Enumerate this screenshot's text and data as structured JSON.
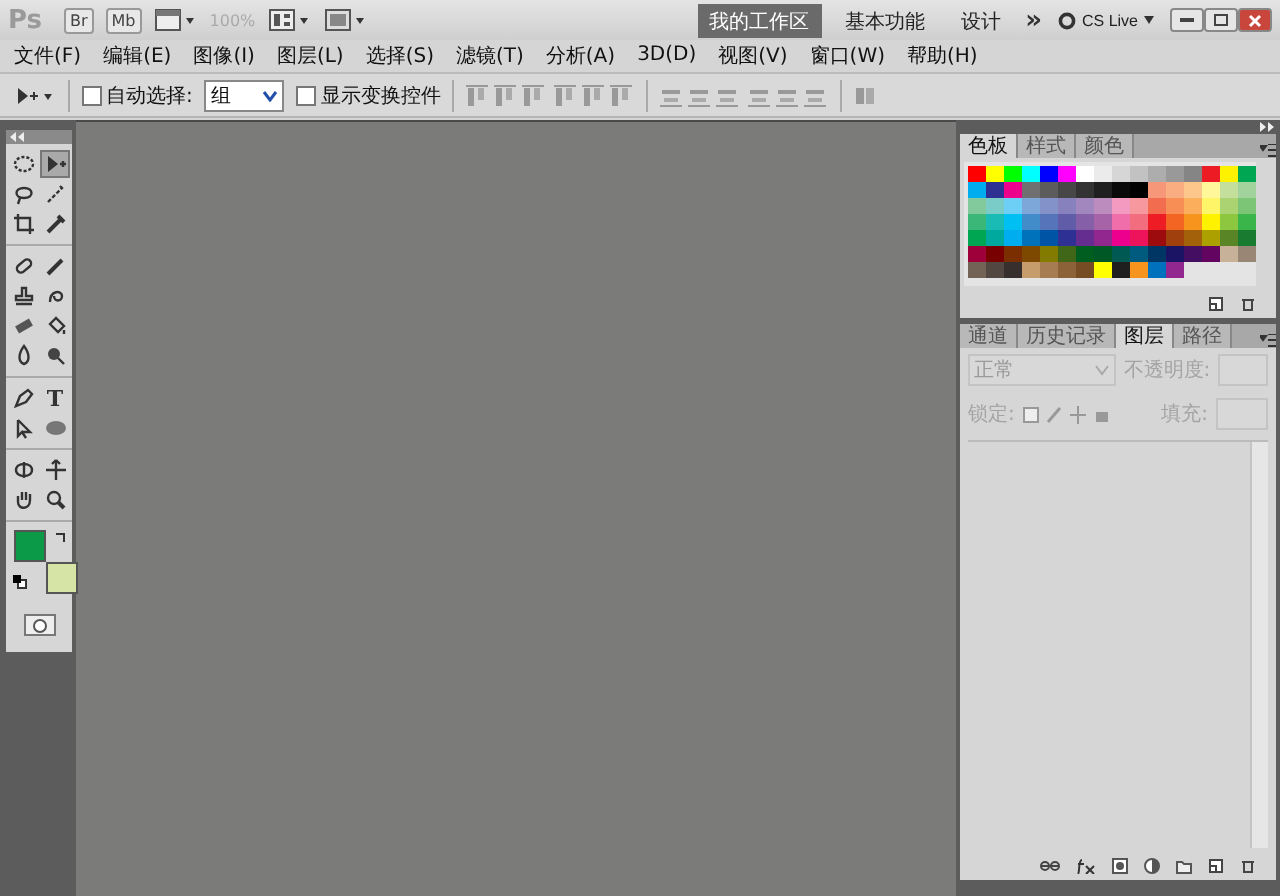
{
  "app_bar": {
    "logo": "Ps",
    "bridge": "Br",
    "mini_bridge": "Mb",
    "zoom": "100%",
    "workspaces": [
      {
        "label": "我的工作区",
        "selected": true
      },
      {
        "label": "基本功能",
        "selected": false
      },
      {
        "label": "设计",
        "selected": false
      }
    ],
    "more": "»",
    "cs_live": "CS Live"
  },
  "menu": [
    "文件(F)",
    "编辑(E)",
    "图像(I)",
    "图层(L)",
    "选择(S)",
    "滤镜(T)",
    "分析(A)",
    "3D(D)",
    "视图(V)",
    "窗口(W)",
    "帮助(H)"
  ],
  "options_bar": {
    "auto_select": {
      "label": "自动选择:",
      "checked": false
    },
    "auto_select_target": "组",
    "show_transform": {
      "label": "显示变换控件",
      "checked": false
    }
  },
  "tool_groups": [
    [
      {
        "kind": "marquee",
        "selected": false
      },
      {
        "kind": "move",
        "selected": true
      },
      {
        "kind": "lasso",
        "selected": false
      },
      {
        "kind": "quick-select",
        "selected": false
      },
      {
        "kind": "crop",
        "selected": false
      },
      {
        "kind": "eyedropper",
        "selected": false
      }
    ],
    [
      {
        "kind": "healing",
        "selected": false
      },
      {
        "kind": "brush",
        "selected": false
      },
      {
        "kind": "stamp",
        "selected": false
      },
      {
        "kind": "history-brush",
        "selected": false
      },
      {
        "kind": "eraser",
        "selected": false
      },
      {
        "kind": "bucket",
        "selected": false
      },
      {
        "kind": "blur",
        "selected": false
      },
      {
        "kind": "dodge",
        "selected": false
      }
    ],
    [
      {
        "kind": "pen",
        "selected": false
      },
      {
        "kind": "type",
        "label": "T",
        "selected": false
      },
      {
        "kind": "path-select",
        "selected": false
      },
      {
        "kind": "shape",
        "selected": false
      }
    ],
    [
      {
        "kind": "rotate-3d",
        "selected": false
      },
      {
        "kind": "camera-3d",
        "selected": false
      },
      {
        "kind": "hand",
        "selected": false
      },
      {
        "kind": "zoom",
        "selected": false
      }
    ]
  ],
  "colors": {
    "foreground": {
      "color": "#0b9a47"
    },
    "background": {
      "color": "#d6e4a6"
    }
  },
  "swatches_panel": {
    "tabs": [
      {
        "label": "色板",
        "selected": true
      },
      {
        "label": "样式",
        "selected": false
      },
      {
        "label": "颜色",
        "selected": false
      }
    ],
    "rows": [
      [
        {
          "color": "#ff0000"
        },
        {
          "color": "#ffff00"
        },
        {
          "color": "#00ff00"
        },
        {
          "color": "#00ffff"
        },
        {
          "color": "#0000ff"
        },
        {
          "color": "#ff00ff"
        },
        {
          "color": "#ffffff"
        },
        {
          "color": "#ebebeb"
        },
        {
          "color": "#d6d6d6"
        },
        {
          "color": "#c2c2c2"
        },
        {
          "color": "#adadad"
        },
        {
          "color": "#999999"
        },
        {
          "color": "#858585"
        },
        {
          "color": "#ed1c24"
        },
        {
          "color": "#fff200"
        },
        {
          "color": "#00a651"
        }
      ],
      [
        {
          "color": "#00aeef"
        },
        {
          "color": "#2e3192"
        },
        {
          "color": "#ec008c"
        },
        {
          "color": "#707070"
        },
        {
          "color": "#5c5c5c"
        },
        {
          "color": "#474747"
        },
        {
          "color": "#333333"
        },
        {
          "color": "#1f1f1f"
        },
        {
          "color": "#0a0a0a"
        },
        {
          "color": "#000000"
        },
        {
          "color": "#f7977a"
        },
        {
          "color": "#f9ad81"
        },
        {
          "color": "#fdc68a"
        },
        {
          "color": "#fff79a"
        },
        {
          "color": "#c4df9b"
        },
        {
          "color": "#a3d39c"
        }
      ],
      [
        {
          "color": "#82ca9c"
        },
        {
          "color": "#7accc8"
        },
        {
          "color": "#6dcff6"
        },
        {
          "color": "#7da7d9"
        },
        {
          "color": "#8393ca"
        },
        {
          "color": "#8781bd"
        },
        {
          "color": "#a187be"
        },
        {
          "color": "#bd8cbf"
        },
        {
          "color": "#f49ac1"
        },
        {
          "color": "#f6989d"
        },
        {
          "color": "#f26c4f"
        },
        {
          "color": "#f68e56"
        },
        {
          "color": "#fbaf5d"
        },
        {
          "color": "#fff568"
        },
        {
          "color": "#acd372"
        },
        {
          "color": "#7cc576"
        }
      ],
      [
        {
          "color": "#3bb878"
        },
        {
          "color": "#1abbb4"
        },
        {
          "color": "#00bff3"
        },
        {
          "color": "#438cca"
        },
        {
          "color": "#5574b9"
        },
        {
          "color": "#605ca8"
        },
        {
          "color": "#855fa8"
        },
        {
          "color": "#a763a8"
        },
        {
          "color": "#f06ea9"
        },
        {
          "color": "#f26d7d"
        },
        {
          "color": "#ed1c25"
        },
        {
          "color": "#f26522"
        },
        {
          "color": "#f7941d"
        },
        {
          "color": "#fff201"
        },
        {
          "color": "#8dc73f"
        },
        {
          "color": "#39b54a"
        }
      ],
      [
        {
          "color": "#00a652"
        },
        {
          "color": "#00a99d"
        },
        {
          "color": "#00aef0"
        },
        {
          "color": "#0072bc"
        },
        {
          "color": "#0054a6"
        },
        {
          "color": "#2e3193"
        },
        {
          "color": "#662d91"
        },
        {
          "color": "#92278f"
        },
        {
          "color": "#ec008d"
        },
        {
          "color": "#ed145b"
        },
        {
          "color": "#9e0b0f"
        },
        {
          "color": "#a0410d"
        },
        {
          "color": "#a36209"
        },
        {
          "color": "#aba000"
        },
        {
          "color": "#598527"
        },
        {
          "color": "#197b30"
        }
      ],
      [
        {
          "color": "#9e0039"
        },
        {
          "color": "#790000"
        },
        {
          "color": "#7b2e00"
        },
        {
          "color": "#7d4900"
        },
        {
          "color": "#827b00"
        },
        {
          "color": "#406618"
        },
        {
          "color": "#005e20"
        },
        {
          "color": "#005826"
        },
        {
          "color": "#005952"
        },
        {
          "color": "#005b7f"
        },
        {
          "color": "#003663"
        },
        {
          "color": "#1b1464"
        },
        {
          "color": "#440e62"
        },
        {
          "color": "#630460"
        },
        {
          "color": "#c7b299"
        },
        {
          "color": "#998675"
        }
      ],
      [
        {
          "color": "#736357"
        },
        {
          "color": "#534741"
        },
        {
          "color": "#362f2d"
        },
        {
          "color": "#c69c6d"
        },
        {
          "color": "#a67c52"
        },
        {
          "color": "#8c6239"
        },
        {
          "color": "#754c24"
        },
        {
          "color": "#ffff01"
        },
        {
          "color": "#1f1f20"
        },
        {
          "color": "#f7941e"
        },
        {
          "color": "#0072bd"
        },
        {
          "color": "#922790"
        }
      ]
    ]
  },
  "layers_panel": {
    "tabs": [
      {
        "label": "通道",
        "selected": false
      },
      {
        "label": "历史记录",
        "selected": false
      },
      {
        "label": "图层",
        "selected": true
      },
      {
        "label": "路径",
        "selected": false
      }
    ],
    "blend_mode": "正常",
    "opacity_label": "不透明度:",
    "lock_label": "锁定:",
    "fill_label": "填充:"
  }
}
